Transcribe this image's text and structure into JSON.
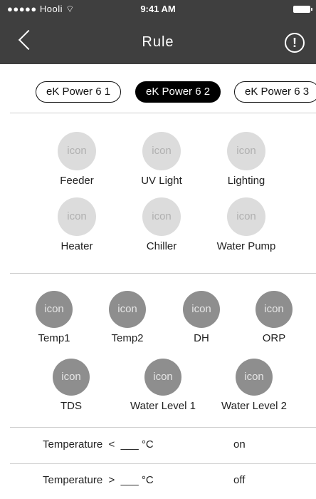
{
  "status_bar": {
    "carrier": "●●●●● Hooli",
    "wifi": "⌔",
    "time": "9:41 AM"
  },
  "nav": {
    "title": "Rule",
    "info_glyph": "!"
  },
  "tabs": [
    {
      "label": "eK Power 6 1",
      "active": false
    },
    {
      "label": "eK Power 6 2",
      "active": true
    },
    {
      "label": "eK Power 6 3",
      "active": false
    }
  ],
  "outputs": [
    {
      "icon": "icon",
      "label": "Feeder"
    },
    {
      "icon": "icon",
      "label": "UV Light"
    },
    {
      "icon": "icon",
      "label": "Lighting"
    },
    {
      "icon": "icon",
      "label": "Heater"
    },
    {
      "icon": "icon",
      "label": "Chiller"
    },
    {
      "icon": "icon",
      "label": "Water Pump"
    }
  ],
  "sensors": [
    {
      "icon": "icon",
      "label": "Temp1"
    },
    {
      "icon": "icon",
      "label": "Temp2"
    },
    {
      "icon": "icon",
      "label": "DH"
    },
    {
      "icon": "icon",
      "label": "ORP"
    },
    {
      "icon": "icon",
      "label": "TDS"
    },
    {
      "icon": "icon",
      "label": "Water Level 1"
    },
    {
      "icon": "icon",
      "label": "Water Level 2"
    }
  ],
  "rules": [
    {
      "text": "Temperature  <  ___ °C",
      "state": "on"
    },
    {
      "text": "Temperature  >  ___ °C",
      "state": "off"
    }
  ],
  "colors": {
    "header_bg": "#3f3f3f",
    "active_tab": "#000000",
    "output_icon": "#dcdcdc",
    "sensor_icon": "#8e8e8e"
  }
}
